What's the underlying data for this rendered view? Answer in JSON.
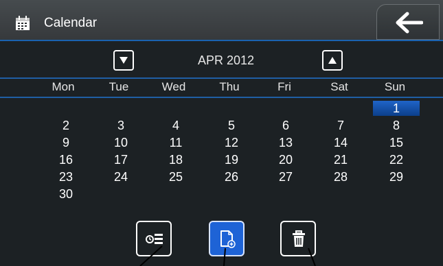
{
  "header": {
    "title": "Calendar",
    "icon": "calendar-icon",
    "back_icon": "back-arrow-icon"
  },
  "month_nav": {
    "label": "APR 2012",
    "prev_icon": "arrow-down-icon",
    "next_icon": "arrow-up-icon"
  },
  "weekdays": [
    "Mon",
    "Tue",
    "Wed",
    "Thu",
    "Fri",
    "Sat",
    "Sun"
  ],
  "days": {
    "d1": "1",
    "d2": "2",
    "d3": "3",
    "d4": "4",
    "d5": "5",
    "d6": "6",
    "d7": "7",
    "d8": "8",
    "d9": "9",
    "d10": "10",
    "d11": "11",
    "d12": "12",
    "d13": "13",
    "d14": "14",
    "d15": "15",
    "d16": "16",
    "d17": "17",
    "d18": "18",
    "d19": "19",
    "d20": "20",
    "d21": "21",
    "d22": "22",
    "d23": "23",
    "d24": "24",
    "d25": "25",
    "d26": "26",
    "d27": "27",
    "d28": "28",
    "d29": "29",
    "d30": "30"
  },
  "selected_day": "1",
  "actions": [
    {
      "icon": "schedule-list-icon"
    },
    {
      "icon": "new-event-icon"
    },
    {
      "icon": "trash-icon"
    }
  ],
  "colors": {
    "accent": "#1e63d6",
    "background": "#1c2124",
    "rule": "#1f5fa5"
  }
}
